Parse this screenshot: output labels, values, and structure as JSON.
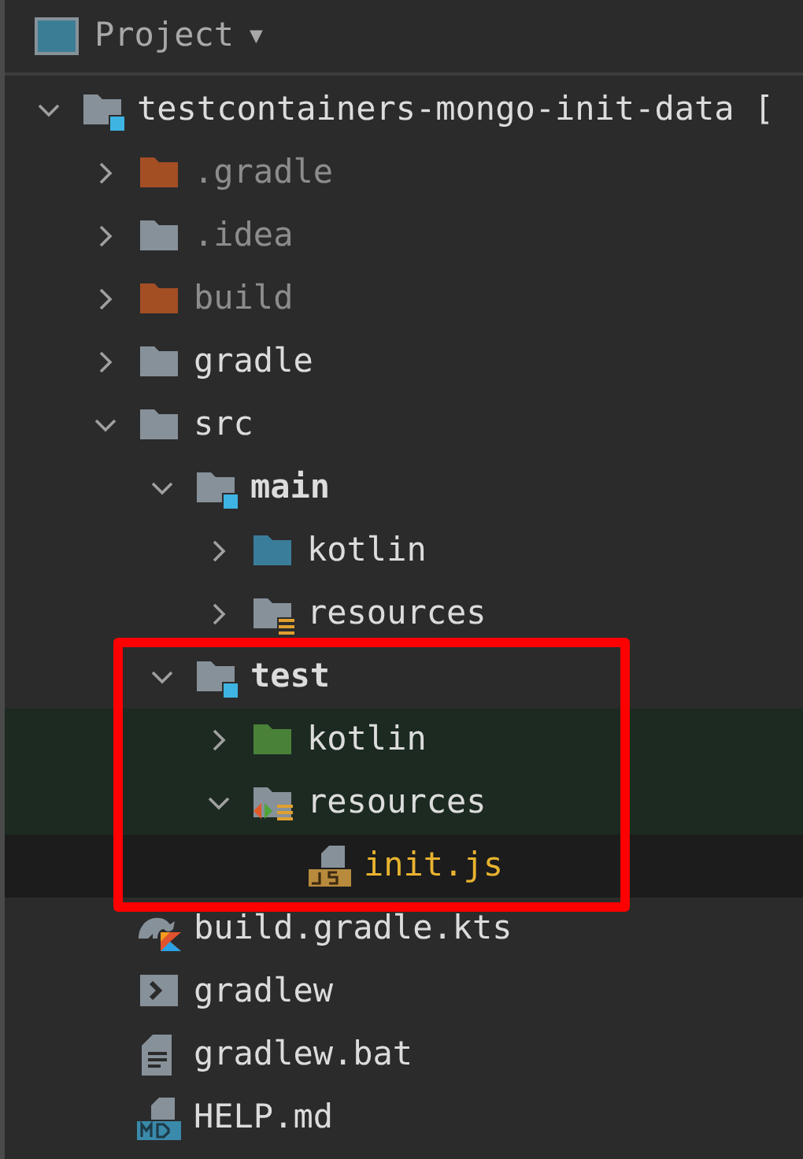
{
  "header": {
    "title": "Project",
    "caret": "▼"
  },
  "tree": [
    {
      "label": "testcontainers-mongo-init-data [",
      "kind": "project",
      "excluded": false,
      "changed": false,
      "expanded": true,
      "selected": false,
      "highlighted": false,
      "children": [
        {
          "label": ".gradle",
          "kind": "excluded-folder",
          "excluded": true,
          "changed": false,
          "expanded": false,
          "selected": false,
          "highlighted": false
        },
        {
          "label": ".idea",
          "kind": "folder",
          "excluded": true,
          "changed": false,
          "expanded": false,
          "selected": false,
          "highlighted": false
        },
        {
          "label": "build",
          "kind": "excluded-folder",
          "excluded": true,
          "changed": false,
          "expanded": false,
          "selected": false,
          "highlighted": false
        },
        {
          "label": "gradle",
          "kind": "folder",
          "excluded": false,
          "changed": false,
          "expanded": false,
          "selected": false,
          "highlighted": false
        },
        {
          "label": "src",
          "kind": "folder",
          "excluded": false,
          "changed": false,
          "expanded": true,
          "selected": false,
          "highlighted": false,
          "children": [
            {
              "label": "main",
              "kind": "module",
              "excluded": false,
              "changed": false,
              "expanded": true,
              "selected": false,
              "highlighted": false,
              "children": [
                {
                  "label": "kotlin",
                  "kind": "source-folder",
                  "excluded": false,
                  "changed": false,
                  "expanded": false,
                  "selected": false,
                  "highlighted": false
                },
                {
                  "label": "resources",
                  "kind": "resources-folder",
                  "excluded": false,
                  "changed": false,
                  "expanded": false,
                  "selected": false,
                  "highlighted": false
                }
              ]
            },
            {
              "label": "test",
              "kind": "module",
              "excluded": false,
              "changed": false,
              "expanded": true,
              "selected": false,
              "highlighted": false,
              "children": [
                {
                  "label": "kotlin",
                  "kind": "test-folder",
                  "excluded": false,
                  "changed": false,
                  "expanded": false,
                  "selected": false,
                  "highlighted": true
                },
                {
                  "label": "resources",
                  "kind": "test-resources-folder",
                  "excluded": false,
                  "changed": false,
                  "expanded": true,
                  "selected": false,
                  "highlighted": true,
                  "children": [
                    {
                      "label": "init.js",
                      "kind": "js-file",
                      "excluded": false,
                      "changed": true,
                      "selected": true,
                      "highlighted": false
                    }
                  ]
                }
              ]
            }
          ]
        },
        {
          "label": "build.gradle.kts",
          "kind": "gradle-file",
          "excluded": false,
          "changed": false,
          "selected": false,
          "highlighted": false
        },
        {
          "label": "gradlew",
          "kind": "script-file",
          "excluded": false,
          "changed": false,
          "selected": false,
          "highlighted": false
        },
        {
          "label": "gradlew.bat",
          "kind": "text-file",
          "excluded": false,
          "changed": false,
          "selected": false,
          "highlighted": false
        },
        {
          "label": "HELP.md",
          "kind": "md-file",
          "excluded": false,
          "changed": false,
          "selected": false,
          "highlighted": false
        }
      ]
    }
  ]
}
